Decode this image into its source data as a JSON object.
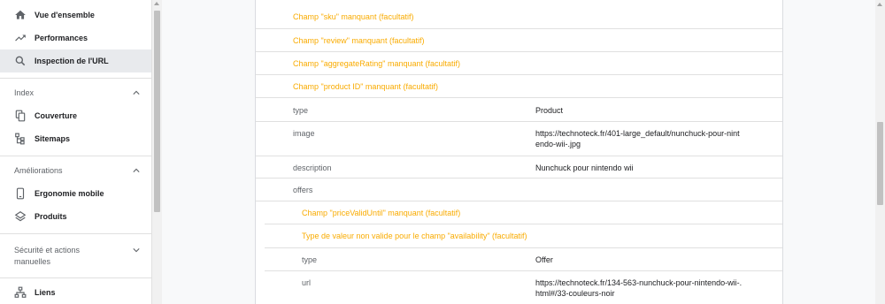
{
  "sidebar": {
    "items_top": [
      {
        "label": "Vue d'ensemble",
        "icon": "home-icon"
      },
      {
        "label": "Performances",
        "icon": "trending-up-icon"
      },
      {
        "label": "Inspection de l'URL",
        "icon": "search-icon",
        "active": true
      }
    ],
    "section_index": {
      "title": "Index",
      "items": [
        {
          "label": "Couverture",
          "icon": "copy-icon"
        },
        {
          "label": "Sitemaps",
          "icon": "sitemap-icon"
        }
      ]
    },
    "section_ameliorations": {
      "title": "Améliorations",
      "items": [
        {
          "label": "Ergonomie mobile",
          "icon": "smartphone-icon"
        },
        {
          "label": "Produits",
          "icon": "layers-icon"
        }
      ]
    },
    "section_securite": {
      "title_line1": "Sécurité et actions",
      "title_line2": "manuelles"
    },
    "liens": {
      "label": "Liens",
      "icon": "links-icon"
    }
  },
  "details": {
    "warn_sku": "Champ \"sku\" manquant (facultatif)",
    "warn_review": "Champ \"review\" manquant (facultatif)",
    "warn_aggregate": "Champ \"aggregateRating\" manquant (facultatif)",
    "warn_productid": "Champ \"product ID\" manquant (facultatif)",
    "type_key": "type",
    "type_val": "Product",
    "image_key": "image",
    "image_val_1": "https://technoteck.fr/401-large_default/nunchuck-pour-nint",
    "image_val_2": "endo-wii-.jpg",
    "desc_key": "description",
    "desc_val": "Nunchuck pour nintendo wii",
    "offers_key": "offers",
    "warn_pricevalid": "Champ \"priceValidUntil\" manquant (facultatif)",
    "warn_availability": "Type de valeur non valide pour le champ \"availability\" (facultatif)",
    "offer_type_key": "type",
    "offer_type_val": "Offer",
    "url_key": "url",
    "url_val_1": "https://technoteck.fr/134-563-nunchuck-pour-nintendo-wii-.",
    "url_val_2": "html#/33-couleurs-noir"
  },
  "colors": {
    "warning": "#f9ab00",
    "active_bg": "#e8eaed"
  }
}
